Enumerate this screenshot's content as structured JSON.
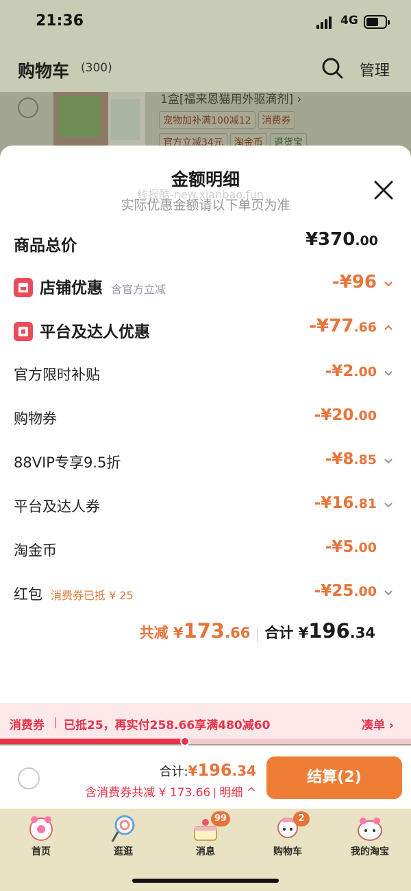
{
  "status_bar": {
    "time": "21:36",
    "network": "4G"
  },
  "header": {
    "title": "购物车",
    "count": "(300)",
    "manage_label": "管理"
  },
  "product": {
    "title": "1盒[福来恩猫用外驱滴剂] ›",
    "tags": [
      "宠物加补满100减12",
      "消费券",
      "官方立减34元",
      "淘金币",
      "退货宝"
    ]
  },
  "sheet": {
    "title": "金额明细",
    "subtitle": "实际优惠金额请以下单页为准",
    "watermark": "线报酷-new.xianbao.fun",
    "goods_total": {
      "label": "商品总价",
      "int": "¥370",
      "dec": ".00"
    },
    "store_discount": {
      "label": "店铺优惠",
      "note": "含官方立减",
      "int": "-¥96",
      "dec": ""
    },
    "platform_discount": {
      "label": "平台及达人优惠",
      "int": "-¥77",
      "dec": ".66"
    },
    "items": [
      {
        "label": "官方限时补贴",
        "note": "",
        "int": "-¥2",
        "dec": ".00",
        "chevron": true
      },
      {
        "label": "购物券",
        "note": "",
        "int": "-¥20",
        "dec": ".00",
        "chevron": false
      },
      {
        "label": "88VIP专享9.5折",
        "note": "",
        "int": "-¥8",
        "dec": ".85",
        "chevron": true
      },
      {
        "label": "平台及达人券",
        "note": "",
        "int": "-¥16",
        "dec": ".81",
        "chevron": true
      },
      {
        "label": "淘金币",
        "note": "",
        "int": "-¥5",
        "dec": ".00",
        "chevron": false
      },
      {
        "label": "红包",
        "note": "消费券已抵 ¥ 25",
        "int": "-¥25",
        "dec": ".00",
        "chevron": true
      }
    ],
    "summary": {
      "saved_label": "共减 ¥",
      "saved_int": "173",
      "saved_dec": ".66",
      "sum_label": "合计 ¥",
      "sum_int": "196",
      "sum_dec": ".34"
    }
  },
  "promo": {
    "tag": "消费券",
    "text": "已抵25，再实付258.66享满480减60",
    "link": "凑单 ›",
    "progress": 0.45
  },
  "checkout": {
    "total_label": "合计:",
    "total_currency": "¥",
    "total_int": "196",
    "total_dec": ".34",
    "detail_text": "含消费券共减 ¥ 173.66",
    "detail_link": "明细 ^",
    "pay_label": "结算(2)"
  },
  "tabs": [
    {
      "label": "首页",
      "badge": ""
    },
    {
      "label": "逛逛",
      "badge": ""
    },
    {
      "label": "消息",
      "badge": "99"
    },
    {
      "label": "购物车",
      "badge": "2"
    },
    {
      "label": "我的淘宝",
      "badge": ""
    }
  ],
  "colors": {
    "accent": "#e8733a",
    "red": "#e6344a",
    "button": "#f07d35"
  }
}
